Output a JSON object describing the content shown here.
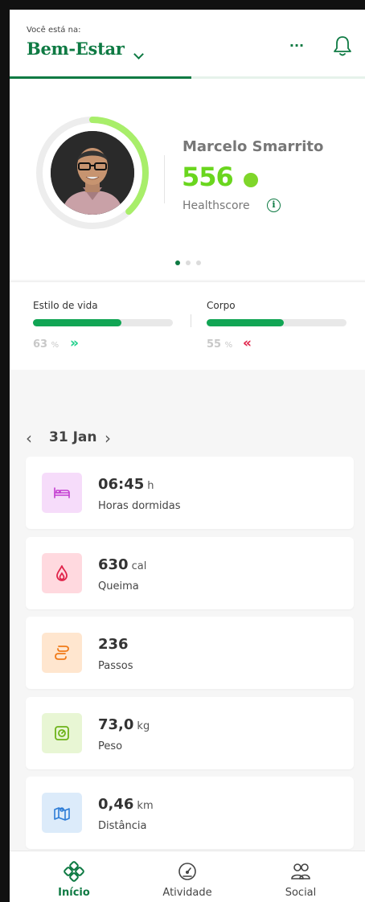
{
  "header": {
    "location_label": "Você está na:",
    "title": "Bem-Estar",
    "more_label": "···"
  },
  "profile": {
    "name": "Marcelo Smarrito",
    "healthscore": "556",
    "healthscore_label": "Healthscore",
    "ring_progress": 0.38,
    "carousel_pages": 3,
    "carousel_active": 1
  },
  "metrics": {
    "lifestyle": {
      "label": "Estilo de vida",
      "percent": 63,
      "pct_text": "63",
      "unit": "%",
      "arrow": "»"
    },
    "body": {
      "label": "Corpo",
      "percent": 55,
      "pct_text": "55",
      "unit": "%",
      "arrow": "«"
    }
  },
  "date": {
    "label": "31 Jan",
    "prev": "‹",
    "next": "›"
  },
  "cards": [
    {
      "value": "06:45",
      "unit": "h",
      "label": "Horas dormidas",
      "icon": "bed-icon",
      "color": "#c43fd1",
      "bg": "#f6dcfa"
    },
    {
      "value": "630",
      "unit": "cal",
      "label": "Queima",
      "icon": "flame-icon",
      "color": "#e0244a",
      "bg": "#ffd9df"
    },
    {
      "value": "236",
      "unit": "",
      "label": "Passos",
      "icon": "footsteps-icon",
      "color": "#f07a18",
      "bg": "#ffe6cf"
    },
    {
      "value": "73,0",
      "unit": "kg",
      "label": "Peso",
      "icon": "scale-icon",
      "color": "#6db31a",
      "bg": "#e8f6d4"
    },
    {
      "value": "0,46",
      "unit": "km",
      "label": "Distância",
      "icon": "map-icon",
      "color": "#2d7cd6",
      "bg": "#dcebfa"
    }
  ],
  "nav": {
    "home": "Início",
    "activity": "Atividade",
    "social": "Social"
  },
  "colors": {
    "brand": "#0e7a43",
    "score": "#6ad61e",
    "bar_fill": "#11a554",
    "arrow_up": "#1fd08a",
    "arrow_down": "#e0244a"
  }
}
